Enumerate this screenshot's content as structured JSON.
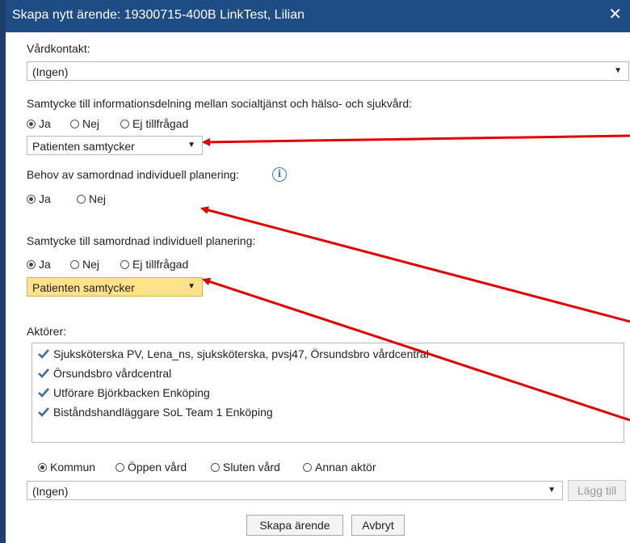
{
  "dialog": {
    "title": "Skapa nytt ärende: 19300715-400B LinkTest, Lilian",
    "close_glyph": "✕"
  },
  "vardkontakt": {
    "label": "Vårdkontakt:",
    "value": "(Ingen)"
  },
  "samtycke_info": {
    "label": "Samtycke till informationsdelning mellan socialtjänst och hälso- och sjukvård:",
    "options": [
      "Ja",
      "Nej",
      "Ej tillfrågad"
    ],
    "selected": "Ja",
    "select_value": "Patienten samtycker"
  },
  "behov_sip": {
    "label": "Behov av samordnad individuell planering:",
    "info_glyph": "i",
    "options": [
      "Ja",
      "Nej"
    ],
    "selected": "Ja"
  },
  "samtycke_sip": {
    "label": "Samtycke till samordnad individuell planering:",
    "options": [
      "Ja",
      "Nej",
      "Ej tillfrågad"
    ],
    "selected": "Ja",
    "select_value": "Patienten samtycker"
  },
  "aktorer": {
    "label": "Aktörer:",
    "items": [
      "Sjuksköterska PV, Lena_ns, sjuksköterska, pvsj47, Örsundsbro vårdcentral",
      "Örsundsbro vårdcentral",
      "Utförare Björkbacken Enköping",
      "Biståndshandläggare SoL Team 1 Enköping"
    ],
    "checked": [
      true,
      true,
      true,
      true
    ]
  },
  "aktor_typ": {
    "options": [
      "Kommun",
      "Öppen vård",
      "Sluten vård",
      "Annan aktör"
    ],
    "selected": "Kommun",
    "select_value": "(Ingen)",
    "add_label": "Lägg till"
  },
  "footer": {
    "create_label": "Skapa ärende",
    "cancel_label": "Avbryt"
  },
  "colors": {
    "titlebar": "#1e4d86",
    "highlight": "#ffe28a",
    "annotation_arrow": "#e00000",
    "checkmark": "#3b6fa8"
  },
  "icons": {
    "close": "close-icon",
    "dropdown": "chevron-down-icon",
    "info": "info-icon",
    "check": "checkmark-icon"
  }
}
